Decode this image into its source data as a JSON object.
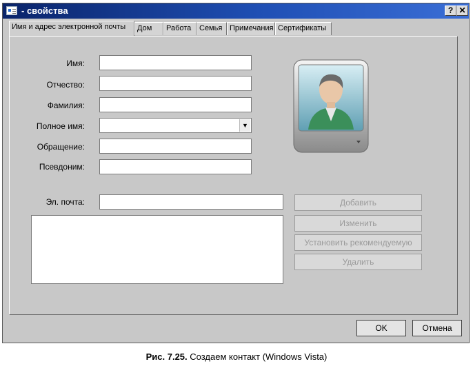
{
  "window": {
    "title": "- свойства",
    "help_btn": "?",
    "close_btn": "✕"
  },
  "tabs": [
    {
      "label": "Имя и адрес электронной почты",
      "active": true
    },
    {
      "label": "Дом"
    },
    {
      "label": "Работа"
    },
    {
      "label": "Семья"
    },
    {
      "label": "Примечания"
    },
    {
      "label": "Сертификаты"
    }
  ],
  "form": {
    "first_name_label": "Имя:",
    "middle_name_label": "Отчество:",
    "last_name_label": "Фамилия:",
    "full_name_label": "Полное имя:",
    "title_label": "Обращение:",
    "nickname_label": "Псевдоним:",
    "email_label": "Эл. почта:",
    "first_name": "",
    "middle_name": "",
    "last_name": "",
    "full_name": "",
    "title": "",
    "nickname": "",
    "email": ""
  },
  "email_buttons": {
    "add": "Добавить",
    "edit": "Изменить",
    "set_preferred": "Установить рекомендуемую",
    "remove": "Удалить"
  },
  "footer": {
    "ok": "OK",
    "cancel": "Отмена"
  },
  "caption": {
    "prefix": "Рис. 7.25.",
    "text": "Создаем контакт (Windows Vista)"
  },
  "icons": {
    "app": "contact-card-icon",
    "photo": "contact-avatar-icon",
    "combo": "chevron-down-icon"
  }
}
